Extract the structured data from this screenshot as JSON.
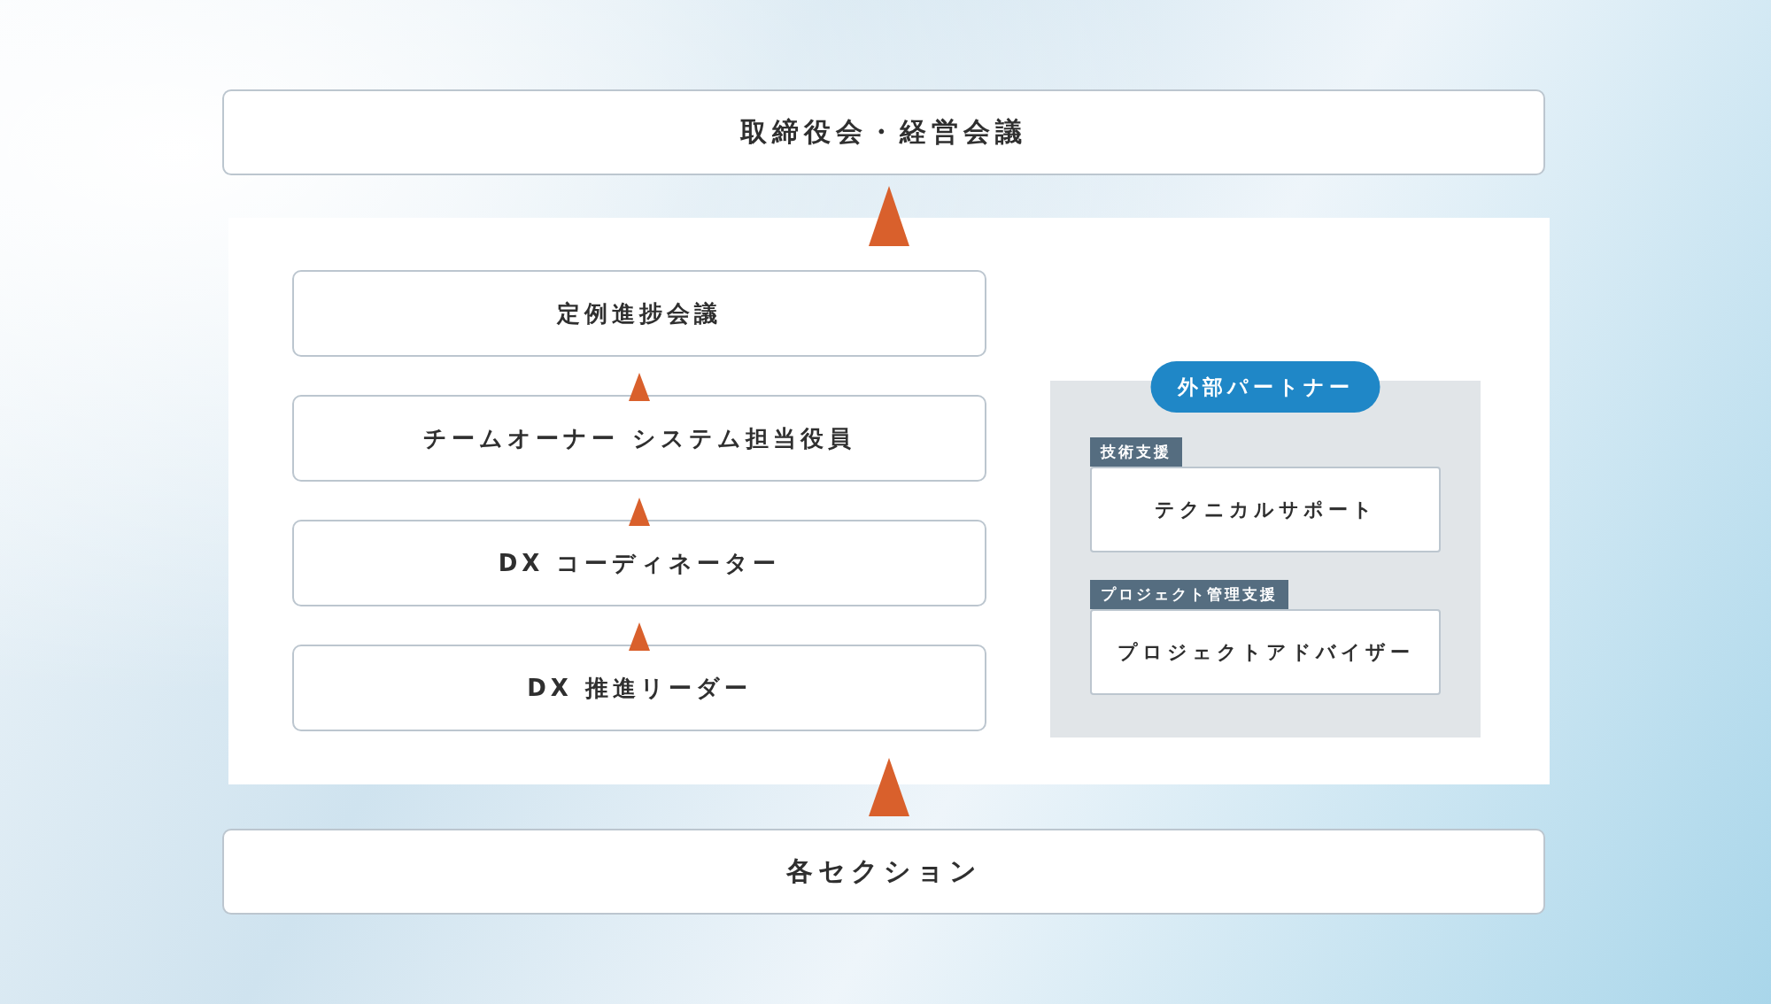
{
  "top_box": {
    "label": "取締役会・経営会議"
  },
  "internal_chain": [
    {
      "label": "定例進捗会議"
    },
    {
      "label": "チームオーナー システム担当役員"
    },
    {
      "label": "DX コーディネーター"
    },
    {
      "label": "DX 推進リーダー"
    }
  ],
  "external_partner": {
    "title": "外部パートナー",
    "groups": [
      {
        "tag": "技術支援",
        "label": "テクニカルサポート"
      },
      {
        "tag": "プロジェクト管理支援",
        "label": "プロジェクトアドバイザー"
      }
    ]
  },
  "bottom_box": {
    "label": "各セクション"
  }
}
